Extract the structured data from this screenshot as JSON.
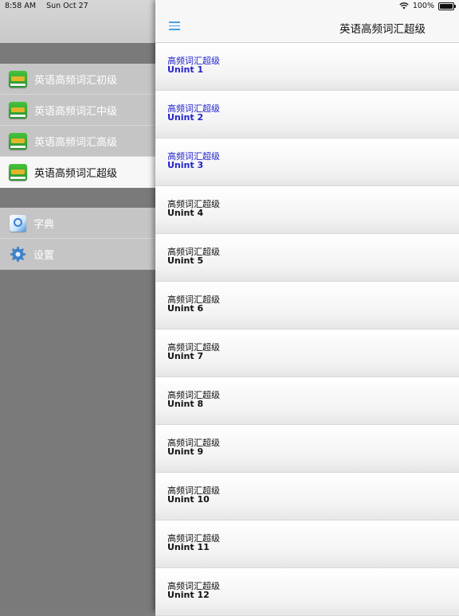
{
  "status": {
    "time": "8:58 AM",
    "date": "Sun Oct 27",
    "battery": "100%"
  },
  "sidebar": {
    "levels": [
      {
        "label": "英语高频词汇初级",
        "selected": false
      },
      {
        "label": "英语高频词汇中级",
        "selected": false
      },
      {
        "label": "英语高频词汇高级",
        "selected": false
      },
      {
        "label": "英语高频词汇超级",
        "selected": true
      }
    ],
    "tools": [
      {
        "label": "字典",
        "icon": "dictionary-icon"
      },
      {
        "label": "设置",
        "icon": "gear-icon"
      }
    ]
  },
  "navbar": {
    "title": "英语高频词汇超级",
    "menu_icon": "hamburger-menu-icon"
  },
  "units": [
    {
      "title": "高频词汇超级",
      "unit": "Unint 1",
      "visited": true
    },
    {
      "title": "高频词汇超级",
      "unit": "Unint 2",
      "visited": true
    },
    {
      "title": "高频词汇超级",
      "unit": "Unint 3",
      "visited": true
    },
    {
      "title": "高频词汇超级",
      "unit": "Unint 4",
      "visited": false
    },
    {
      "title": "高频词汇超级",
      "unit": "Unint 5",
      "visited": false
    },
    {
      "title": "高频词汇超级",
      "unit": "Unint 6",
      "visited": false
    },
    {
      "title": "高频词汇超级",
      "unit": "Unint 7",
      "visited": false
    },
    {
      "title": "高频词汇超级",
      "unit": "Unint 8",
      "visited": false
    },
    {
      "title": "高频词汇超级",
      "unit": "Unint 9",
      "visited": false
    },
    {
      "title": "高频词汇超级",
      "unit": "Unint 10",
      "visited": false
    },
    {
      "title": "高频词汇超级",
      "unit": "Unint 11",
      "visited": false
    },
    {
      "title": "高频词汇超级",
      "unit": "Unint 12",
      "visited": false
    }
  ],
  "colors": {
    "visited_link": "#2323cc",
    "menu_icon": "#4aa0e6",
    "sidebar_bg": "#7a7a7a"
  }
}
